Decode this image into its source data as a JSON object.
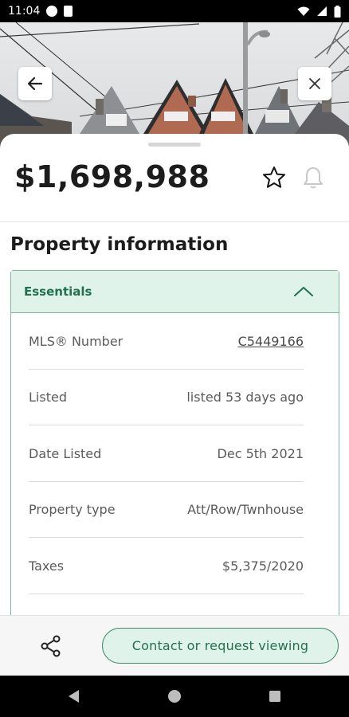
{
  "status_bar": {
    "time": "11:04",
    "icons": [
      "notification-icon",
      "sd-card-icon",
      "wifi-icon",
      "signal-icon",
      "battery-icon"
    ]
  },
  "hero": {
    "back_icon": "arrow-left-icon",
    "close_icon": "close-icon"
  },
  "listing": {
    "price": "$1,698,988",
    "favorite_icon": "star-outline-icon",
    "alert_icon": "bell-outline-icon"
  },
  "section": {
    "title": "Property information"
  },
  "essentials": {
    "title": "Essentials",
    "rows": [
      {
        "label": "MLS® Number",
        "value": "C5449166"
      },
      {
        "label": "Listed",
        "value": "listed 53 days ago"
      },
      {
        "label": "Date Listed",
        "value": "Dec 5th 2021"
      },
      {
        "label": "Property type",
        "value": "Att/Row/Twnhouse"
      },
      {
        "label": "Taxes",
        "value": "$5,375/2020"
      }
    ]
  },
  "actions": {
    "share_icon": "share-icon",
    "cta_label": "Contact or request viewing"
  },
  "colors": {
    "accent_green": "#23704f",
    "accent_bg": "#dff3ea",
    "border_green": "#7fb89e"
  }
}
